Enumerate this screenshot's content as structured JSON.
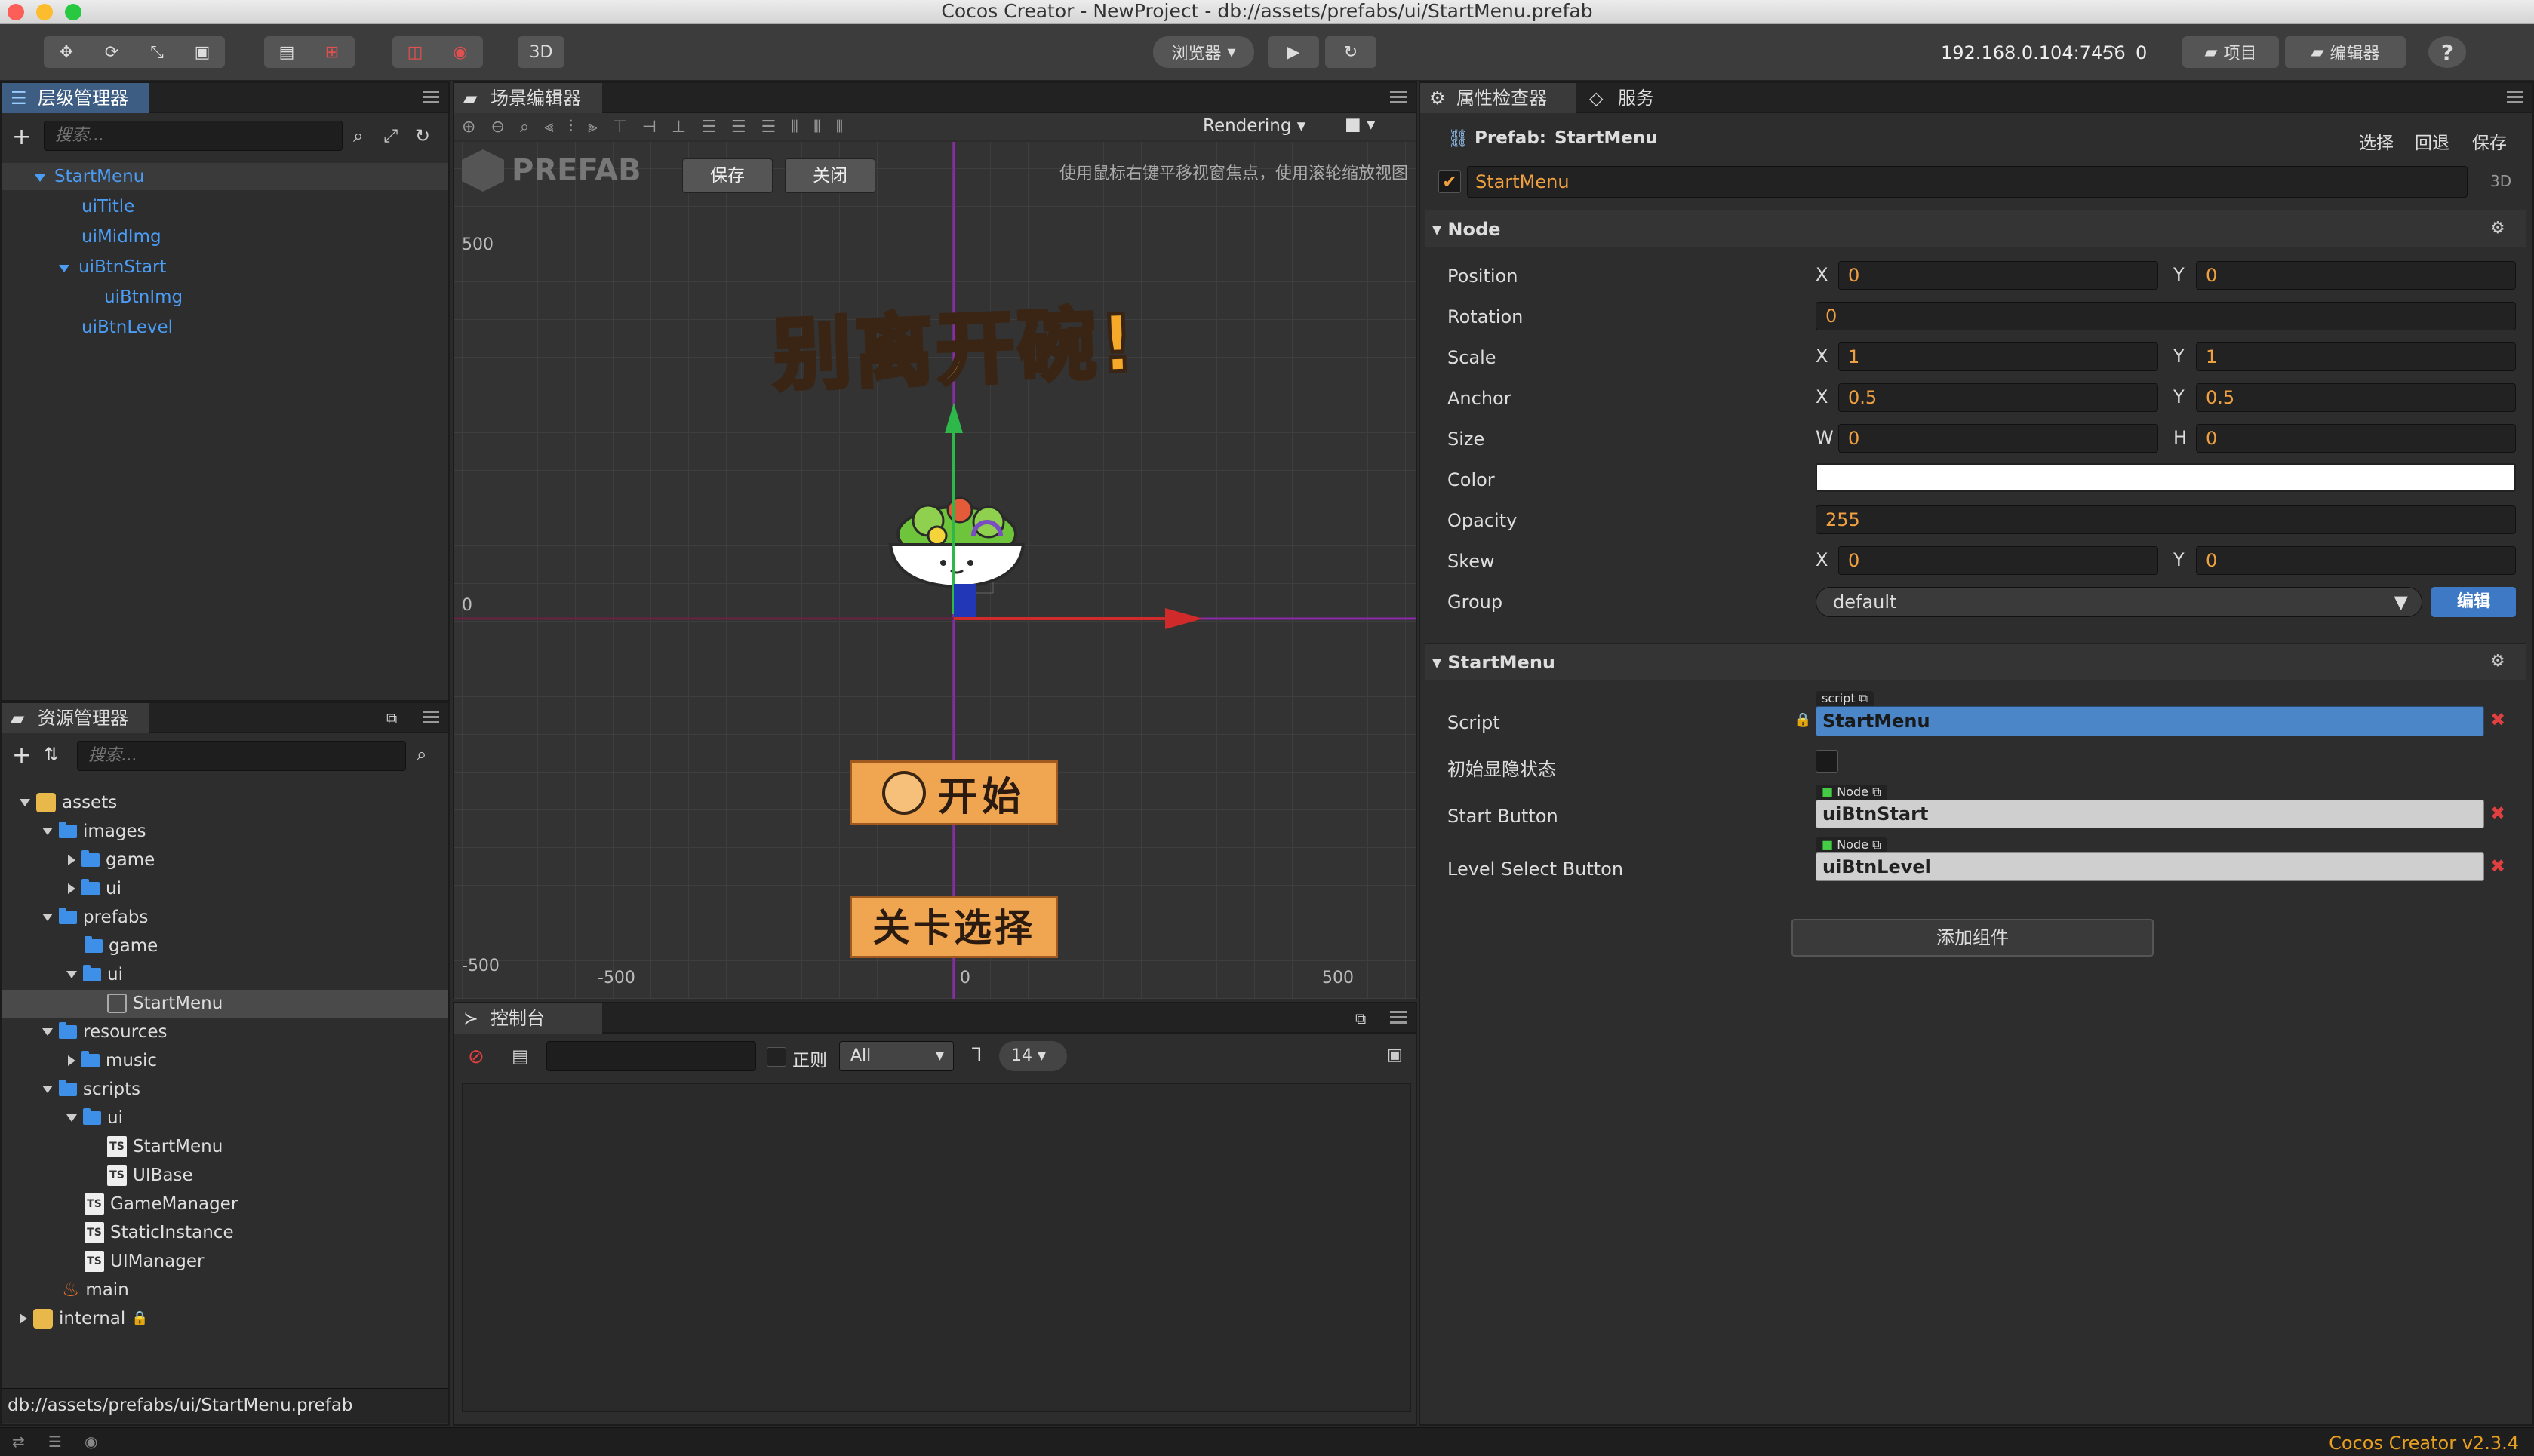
{
  "window": {
    "title": "Cocos Creator - NewProject - db://assets/prefabs/ui/StartMenu.prefab"
  },
  "toolbar": {
    "mode3d": "3D",
    "browser": "浏览器",
    "ip": "192.168.0.104:7456",
    "wifi_count": "0",
    "project": "项目",
    "editor": "编辑器",
    "help": "?"
  },
  "hierarchy": {
    "tab": "层级管理器",
    "search_placeholder": "搜索...",
    "nodes": [
      "StartMenu",
      "uiTitle",
      "uiMidImg",
      "uiBtnStart",
      "uiBtnImg",
      "uiBtnLevel"
    ]
  },
  "assets": {
    "tab": "资源管理器",
    "search_placeholder": "搜索...",
    "items": [
      "assets",
      "images",
      "game",
      "ui",
      "prefabs",
      "game",
      "ui",
      "StartMenu",
      "resources",
      "music",
      "scripts",
      "ui",
      "StartMenu",
      "UIBase",
      "GameManager",
      "StaticInstance",
      "UIManager",
      "main",
      "internal"
    ],
    "status_path": "db://assets/prefabs/ui/StartMenu.prefab"
  },
  "scene": {
    "tab": "场景编辑器",
    "prefab_label": "PREFAB",
    "save": "保存",
    "close": "关闭",
    "hint": "使用鼠标右键平移视窗焦点，使用滚轮缩放视图",
    "rendering": "Rendering",
    "y_labels": [
      "500",
      "0",
      "-500"
    ],
    "x_labels": [
      "-500",
      "0",
      "500"
    ],
    "game_title": "别离开碗!",
    "btn_start": "开始",
    "btn_level": "关卡选择"
  },
  "console": {
    "tab": "控制台",
    "regex": "正则",
    "filter": "All",
    "font_size": "14"
  },
  "inspector": {
    "tab": "属性检查器",
    "tab2": "服务",
    "prefab_label": "Prefab:",
    "prefab_name": "StartMenu",
    "select": "选择",
    "revert": "回退",
    "save": "保存",
    "mode3d": "3D",
    "node_name": "StartMenu",
    "node_section": "Node",
    "position_label": "Position",
    "position_x": "0",
    "position_y": "0",
    "rotation_label": "Rotation",
    "rotation": "0",
    "scale_label": "Scale",
    "scale_x": "1",
    "scale_y": "1",
    "anchor_label": "Anchor",
    "anchor_x": "0.5",
    "anchor_y": "0.5",
    "size_label": "Size",
    "size_w": "0",
    "size_h": "0",
    "color_label": "Color",
    "color_value": "#ffffff",
    "opacity_label": "Opacity",
    "opacity": "255",
    "skew_label": "Skew",
    "skew_x": "0",
    "skew_y": "0",
    "group_label": "Group",
    "group_value": "default",
    "edit": "编辑",
    "component_section": "StartMenu",
    "script_label": "Script",
    "script_tag": "script",
    "script_value": "StartMenu",
    "initial_label": "初始显隐状态",
    "start_btn_label": "Start Button",
    "node_tag": "Node",
    "start_btn_value": "uiBtnStart",
    "level_btn_label": "Level Select Button",
    "level_btn_value": "uiBtnLevel",
    "add_component": "添加组件",
    "xl": "X",
    "yl": "Y",
    "wl": "W",
    "hl": "H"
  },
  "footer": {
    "version": "Cocos Creator v2.3.4"
  }
}
